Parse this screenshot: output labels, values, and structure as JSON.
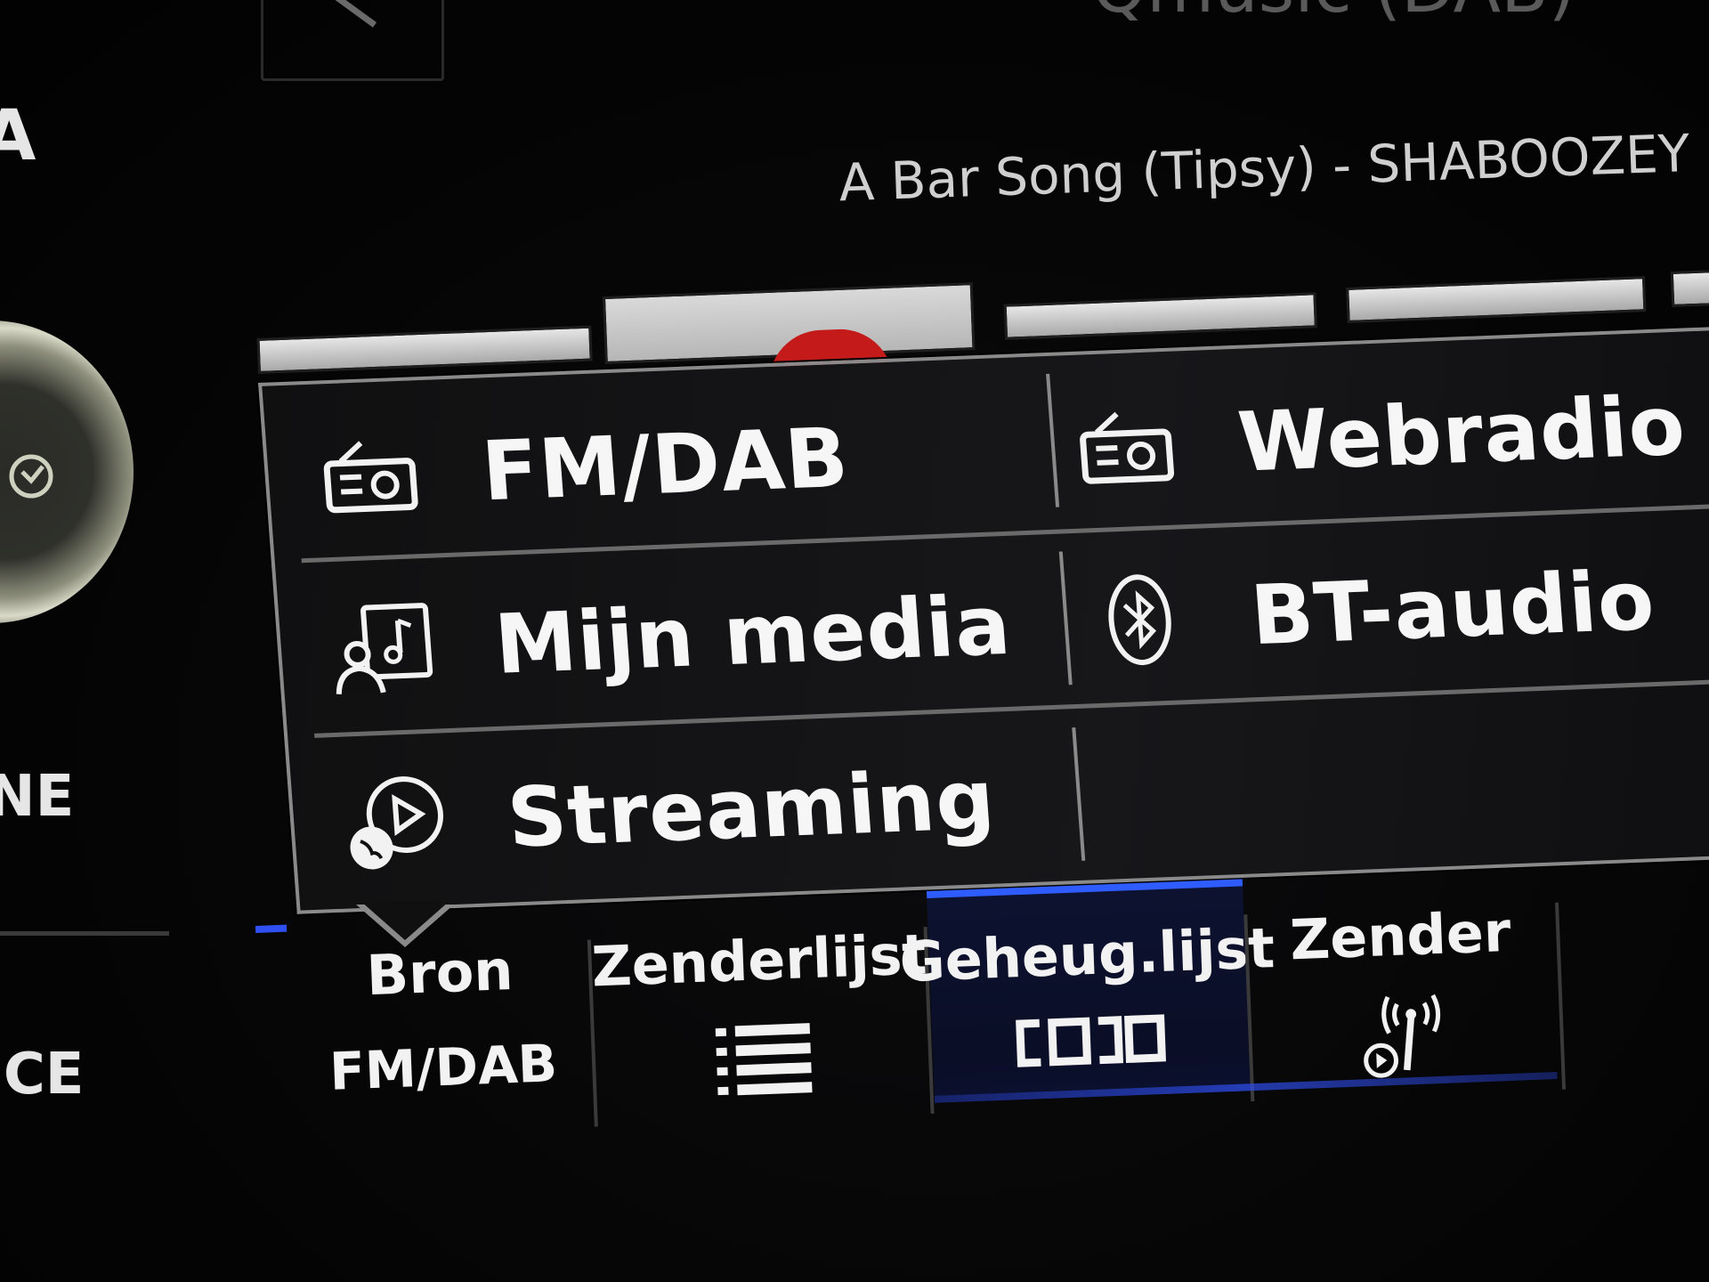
{
  "header": {
    "station_name": "Qmusic (DAB)",
    "now_playing": "A Bar Song (Tipsy) - SHABOOZEY"
  },
  "side_menu": {
    "item_top": "A",
    "item_middle": "NE",
    "item_bottom": "ICE"
  },
  "source_menu": {
    "items": [
      {
        "label": "FM/DAB",
        "icon": "radio-icon"
      },
      {
        "label": "Webradio",
        "icon": "radio-icon"
      },
      {
        "label": "Mijn media",
        "icon": "media-library-icon"
      },
      {
        "label": "BT-audio",
        "icon": "bluetooth-icon"
      },
      {
        "label": "Streaming",
        "icon": "streaming-icon"
      }
    ]
  },
  "bottom_tabs": {
    "bron_label": "Bron",
    "bron_value": "FM/DAB",
    "zenderlijst_label": "Zenderlijst",
    "zenderlijst_icon": "list-icon",
    "geheug_label": "Geheug.lijst",
    "geheug_icon": "preset-list-icon",
    "zender_label": "Zender",
    "zender_icon": "broadcast-antenna-icon"
  },
  "colors": {
    "accent": "#2e5cff",
    "preset_logo": "#c41a1a"
  }
}
